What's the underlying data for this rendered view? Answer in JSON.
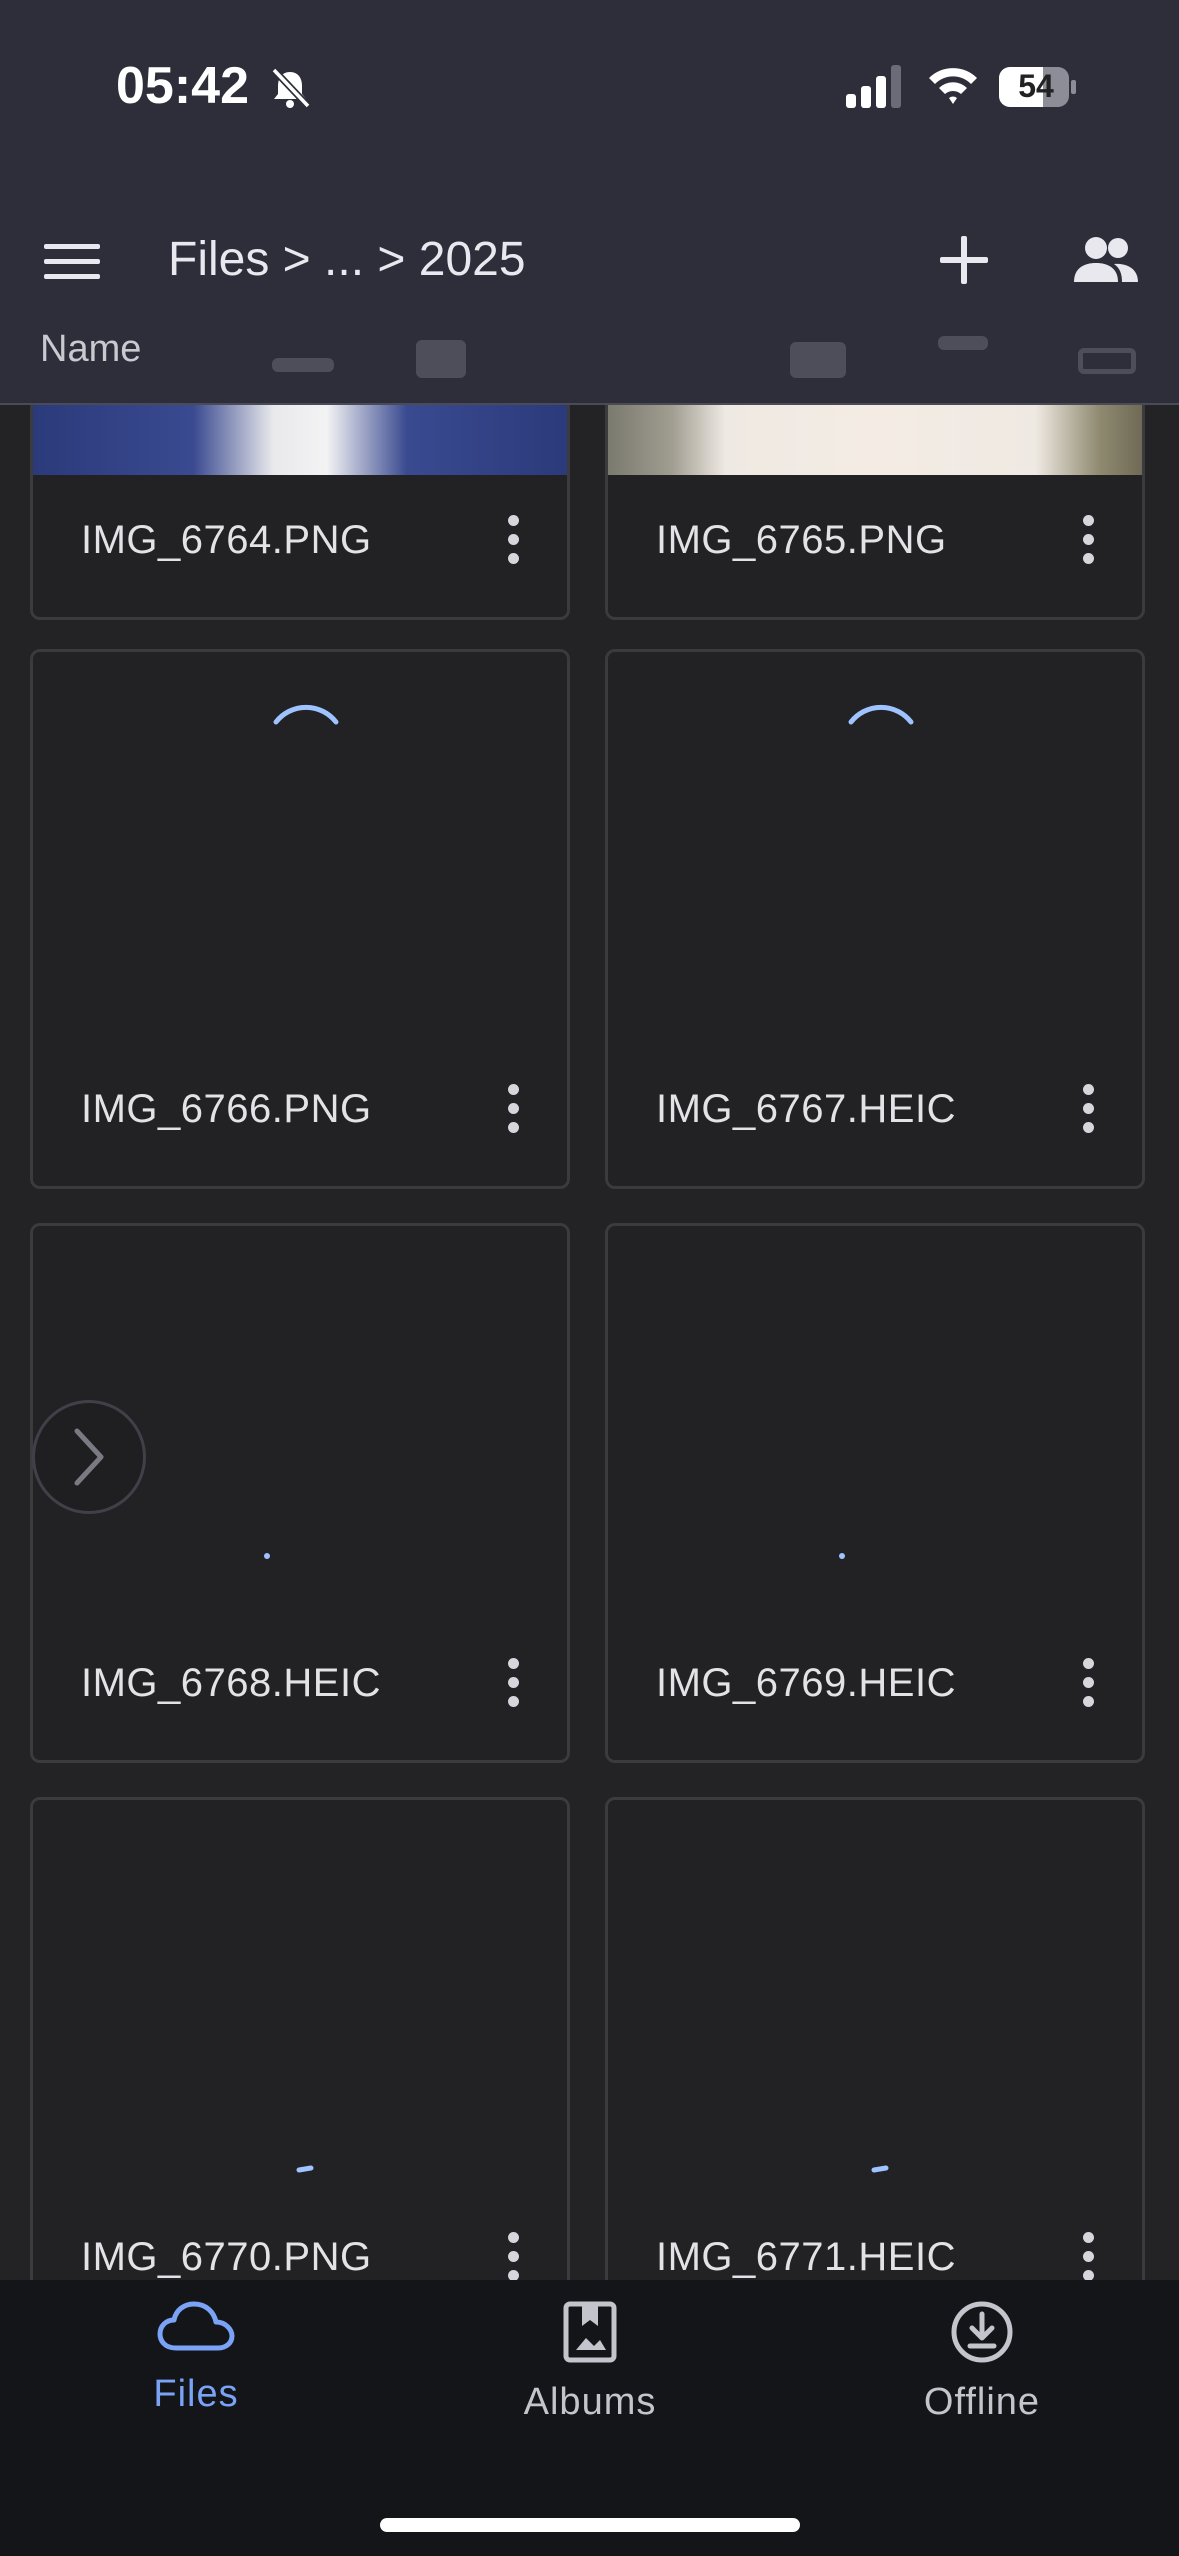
{
  "status": {
    "time": "05:42",
    "battery": "54"
  },
  "header": {
    "breadcrumb": "Files > ... > 2025",
    "sort_label": "Name"
  },
  "files": [
    {
      "name": "IMG_6764.PNG"
    },
    {
      "name": "IMG_6765.PNG"
    },
    {
      "name": "IMG_6766.PNG"
    },
    {
      "name": "IMG_6767.HEIC"
    },
    {
      "name": "IMG_6768.HEIC"
    },
    {
      "name": "IMG_6769.HEIC"
    },
    {
      "name": "IMG_6770.PNG"
    },
    {
      "name": "IMG_6771.HEIC"
    }
  ],
  "nav": {
    "files": "Files",
    "albums": "Albums",
    "offline": "Offline",
    "active": "files"
  },
  "colors": {
    "accent": "#7aa2f7",
    "background": "#232326",
    "header": "#2d2e3a",
    "nav": "#141518"
  },
  "icons": [
    "bell-off-icon",
    "signal-icon",
    "wifi-icon",
    "battery-icon",
    "menu-icon",
    "add-icon",
    "people-icon",
    "more-vert-icon",
    "cloud-icon",
    "album-icon",
    "download-icon",
    "chevron-right-icon"
  ]
}
